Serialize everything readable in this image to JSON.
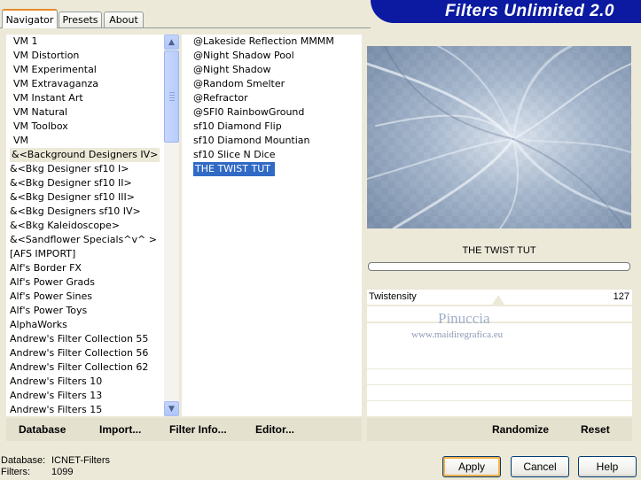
{
  "app": {
    "title": "Filters Unlimited 2.0"
  },
  "tabs": [
    {
      "label": "Navigator",
      "active": true
    },
    {
      "label": "Presets",
      "active": false
    },
    {
      "label": "About",
      "active": false
    }
  ],
  "categories": {
    "items": [
      "VM 1",
      "VM Distortion",
      "VM Experimental",
      "VM Extravaganza",
      "VM Instant Art",
      "VM Natural",
      "VM Toolbox",
      "VM",
      "&<Background Designers IV>",
      "&<Bkg Designer sf10 I>",
      "&<Bkg Designer sf10 II>",
      "&<Bkg Designer sf10 III>",
      "&<Bkg Designers sf10 IV>",
      "&<Bkg Kaleidoscope>",
      "&<Sandflower Specials^v^ >",
      "[AFS IMPORT]",
      "Alf's Border FX",
      "Alf's Power Grads",
      "Alf's Power Sines",
      "Alf's Power Toys",
      "AlphaWorks",
      "Andrew's Filter Collection 55",
      "Andrew's Filter Collection 56",
      "Andrew's Filter Collection 62",
      "Andrew's Filters 10",
      "Andrew's Filters 13",
      "Andrew's Filters 15"
    ],
    "selected": "&<Background Designers IV>"
  },
  "filters": {
    "items": [
      "@Lakeside Reflection MMMM",
      "@Night Shadow Pool",
      "@Night Shadow",
      "@Random Smelter",
      "@Refractor",
      "@SFI0 RainbowGround",
      "sf10 Diamond Flip",
      "sf10 Diamond Mountian",
      "sf10 Slice N Dice",
      "THE TWIST TUT"
    ],
    "selected": "THE TWIST TUT"
  },
  "preview": {
    "filter_name": "THE TWIST TUT",
    "progress": 0
  },
  "parameters": [
    {
      "name": "Twistensity",
      "value": "127"
    }
  ],
  "watermark": {
    "line1": "Pinuccia",
    "line2": "www.maidiregrafica.eu"
  },
  "toolbar": {
    "database": "Database",
    "import": "Import...",
    "filter_info": "Filter Info...",
    "editor": "Editor...",
    "randomize": "Randomize",
    "reset": "Reset"
  },
  "status": {
    "database_label": "Database:",
    "database_value": "ICNET-Filters",
    "filters_label": "Filters:",
    "filters_value": "1099"
  },
  "buttons": {
    "apply": "Apply",
    "cancel": "Cancel",
    "help": "Help"
  },
  "colors": {
    "banner": "#0b1aa0",
    "selection": "#316ac5",
    "tab_accent": "#e68b2c"
  },
  "icons": [
    "scroll-up-icon",
    "scroll-down-icon"
  ]
}
